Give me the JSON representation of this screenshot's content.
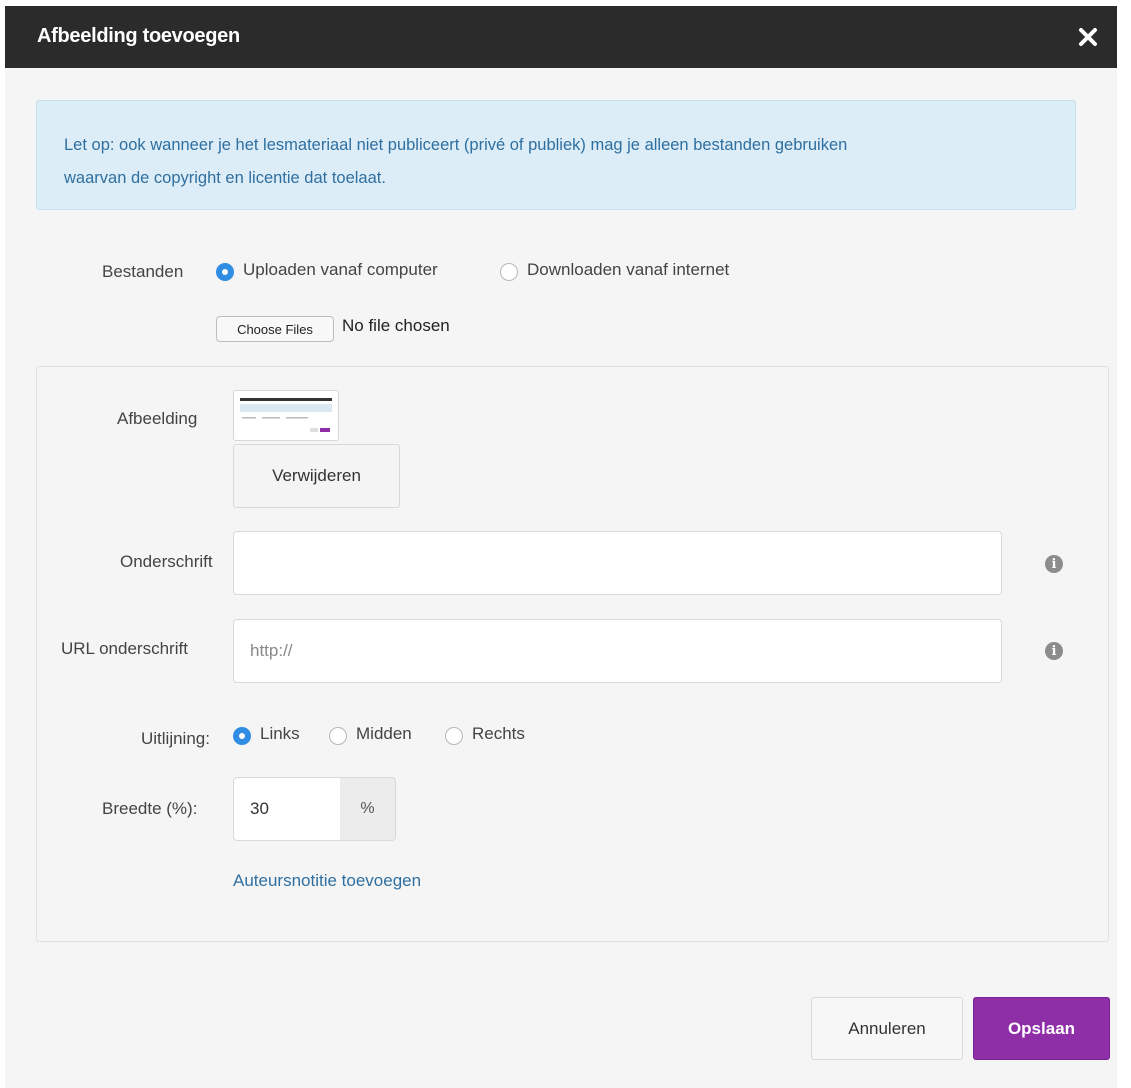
{
  "dialog": {
    "title": "Afbeelding toevoegen"
  },
  "alert": {
    "line1": "Let op: ook wanneer je het lesmateriaal niet publiceert (privé of publiek) mag je alleen bestanden gebruiken",
    "line2": "waarvan de copyright en licentie dat toelaat."
  },
  "files": {
    "label": "Bestanden",
    "option_upload": "Uploaden vanaf computer",
    "option_download": "Downloaden vanaf internet",
    "selected": "upload",
    "choose_button": "Choose Files",
    "status": "No file chosen"
  },
  "image": {
    "label": "Afbeelding",
    "remove_button": "Verwijderen"
  },
  "caption": {
    "label": "Onderschrift",
    "value": ""
  },
  "caption_url": {
    "label": "URL onderschrift",
    "placeholder": "http://"
  },
  "alignment": {
    "label": "Uitlijning:",
    "options": [
      "Links",
      "Midden",
      "Rechts"
    ],
    "selected": "Links"
  },
  "width": {
    "label": "Breedte (%):",
    "value": "30",
    "unit": "%"
  },
  "author_note_link": "Auteursnotitie toevoegen",
  "footer": {
    "cancel": "Annuleren",
    "save": "Opslaan"
  },
  "colors": {
    "header": "#2b2b2b",
    "primary": "#8e2fa8",
    "radio_checked": "#2f8de4",
    "alert_bg": "#dcedf7",
    "link": "#2f6fa0"
  }
}
